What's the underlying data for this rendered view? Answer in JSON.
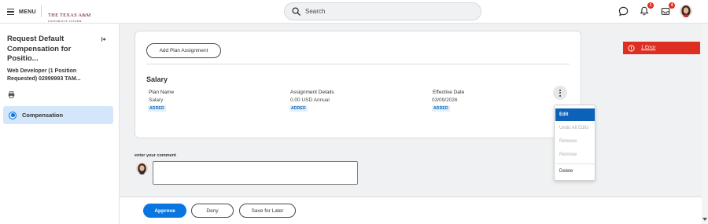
{
  "header": {
    "menu_label": "MENU",
    "logo_main": "THE TEXAS A&M",
    "logo_sub": "UNIVERSITY SYSTEM",
    "search_placeholder": "Search",
    "notifications_count": "1",
    "inbox_count": "4"
  },
  "sidebar": {
    "task_title": "Request Default Compensation for Positio...",
    "task_subtitle": "Web Developer (1 Position Requested) 02999993 TAM...",
    "nav_items": [
      {
        "label": "Compensation",
        "selected": true
      }
    ]
  },
  "main": {
    "add_plan_button": "Add Plan Assignment",
    "section_title": "Salary",
    "columns": [
      {
        "header": "Plan Name",
        "value": "Salary",
        "tag": "ADDED"
      },
      {
        "header": "Assignment Details",
        "value": "0.00 USD Annual",
        "tag": "ADDED"
      },
      {
        "header": "Effective Date",
        "value": "03/09/2026",
        "tag": "ADDED"
      }
    ],
    "menu_items": [
      {
        "label": "Edit",
        "state": "active"
      },
      {
        "label": "Undo All Edits",
        "state": "disabled"
      },
      {
        "label": "Remove",
        "state": "disabled"
      },
      {
        "label": "Remove",
        "state": "disabled"
      },
      {
        "label": "Delete",
        "state": "enabled"
      }
    ]
  },
  "error_banner": {
    "text": "1 Error"
  },
  "comment": {
    "label": "enter your comment",
    "value": ""
  },
  "footer": {
    "approve_label": "Approve",
    "deny_label": "Deny",
    "save_later_label": "Save for Later"
  },
  "colors": {
    "accent": "#0875e1",
    "error": "#de2e21",
    "selected_nav": "#d4e6f9",
    "brand_maroon": "#5c0025"
  },
  "icons": [
    "hamburger-icon",
    "search-icon",
    "chat-icon",
    "bell-icon",
    "inbox-icon",
    "collapse-panel-icon",
    "print-icon",
    "kebab-icon",
    "error-icon"
  ]
}
